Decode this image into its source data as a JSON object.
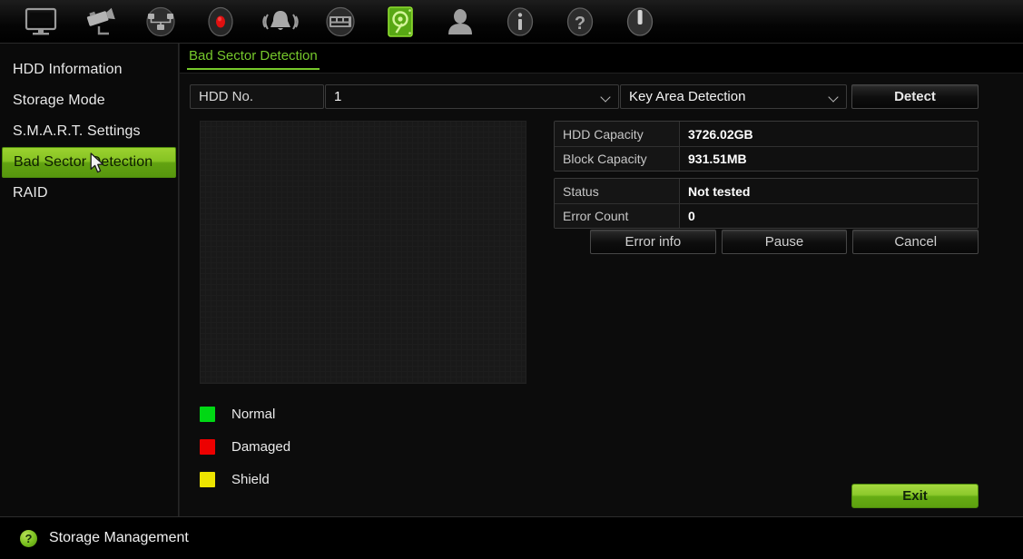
{
  "toolbar": {
    "items": [
      {
        "icon": "monitor-icon",
        "name": "live-view",
        "active": false
      },
      {
        "icon": "camera-icon",
        "name": "camera-setup",
        "active": false
      },
      {
        "icon": "network-icon",
        "name": "network-settings",
        "active": false
      },
      {
        "icon": "record-icon",
        "name": "record-settings",
        "active": false
      },
      {
        "icon": "alarm-icon",
        "name": "alarm-settings",
        "active": false
      },
      {
        "icon": "device-icon",
        "name": "device-settings",
        "active": false
      },
      {
        "icon": "hdd-icon",
        "name": "storage-management",
        "active": true
      },
      {
        "icon": "user-icon",
        "name": "user-management",
        "active": false
      },
      {
        "icon": "info-icon",
        "name": "system-info",
        "active": false
      },
      {
        "icon": "help-icon",
        "name": "help",
        "active": false
      },
      {
        "icon": "power-icon",
        "name": "shutdown",
        "active": false
      }
    ]
  },
  "sidebar": {
    "items": [
      {
        "label": "HDD Information",
        "active": false
      },
      {
        "label": "Storage Mode",
        "active": false
      },
      {
        "label": "S.M.A.R.T. Settings",
        "active": false
      },
      {
        "label": "Bad Sector Detection",
        "active": true
      },
      {
        "label": "RAID",
        "active": false
      }
    ]
  },
  "tab": {
    "label": "Bad Sector Detection"
  },
  "controls": {
    "hdd_label": "HDD No.",
    "hdd_value": "1",
    "mode_value": "Key Area Detection",
    "detect_label": "Detect"
  },
  "legend": [
    {
      "label": "Normal",
      "color": "#00d814"
    },
    {
      "label": "Damaged",
      "color": "#ed0000"
    },
    {
      "label": "Shield",
      "color": "#ede400"
    }
  ],
  "capacity_table": [
    {
      "key": "HDD Capacity",
      "value": "3726.02GB"
    },
    {
      "key": "Block Capacity",
      "value": "931.51MB"
    }
  ],
  "status_table": [
    {
      "key": "Status",
      "value": "Not tested"
    },
    {
      "key": "Error Count",
      "value": "0"
    }
  ],
  "actions": {
    "error_info_label": "Error info",
    "pause_label": "Pause",
    "cancel_label": "Cancel"
  },
  "exit": {
    "label": "Exit"
  },
  "statusbar": {
    "icon": "help-circle-icon",
    "glyph": "?",
    "text": "Storage Management"
  },
  "colors": {
    "accent_green": "#8cc92c",
    "tab_green": "#76c82b",
    "normal": "#00d814",
    "damaged": "#ed0000",
    "shield": "#ede400"
  }
}
